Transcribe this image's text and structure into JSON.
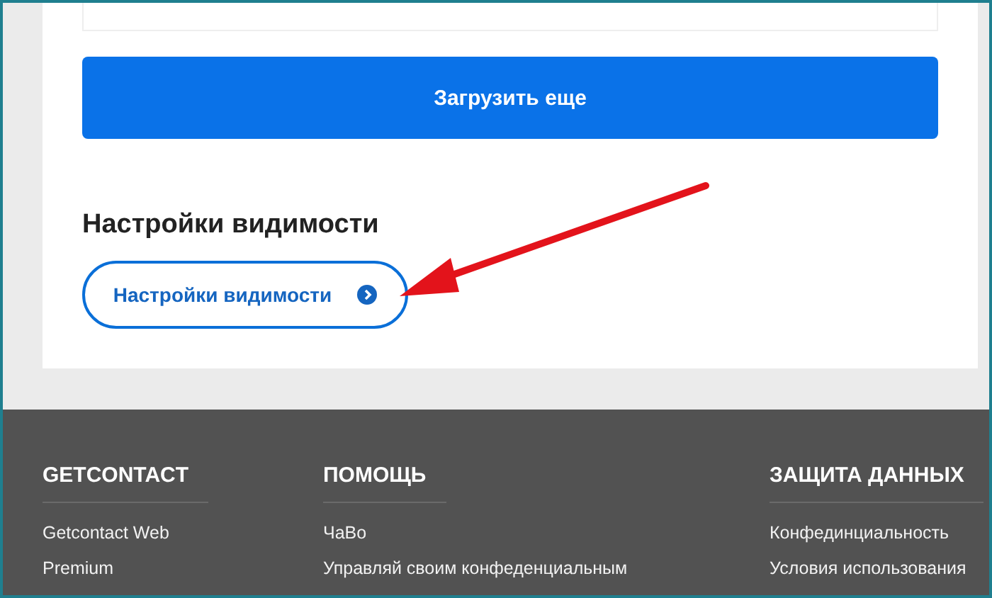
{
  "load_more_button": "Загрузить еще",
  "visibility": {
    "heading": "Настройки видимости",
    "button": "Настройки видимости"
  },
  "footer": {
    "columns": [
      {
        "title": "GETCONTACT",
        "links": [
          "Getcontact Web",
          "Premium"
        ]
      },
      {
        "title": "ПОМОЩЬ",
        "links": [
          "ЧаВо",
          "Управляй своим конфеденциальным"
        ]
      },
      {
        "title": "ЗАЩИТА ДАННЫХ",
        "links": [
          "Конфединциальность",
          "Условия использования"
        ]
      }
    ]
  }
}
